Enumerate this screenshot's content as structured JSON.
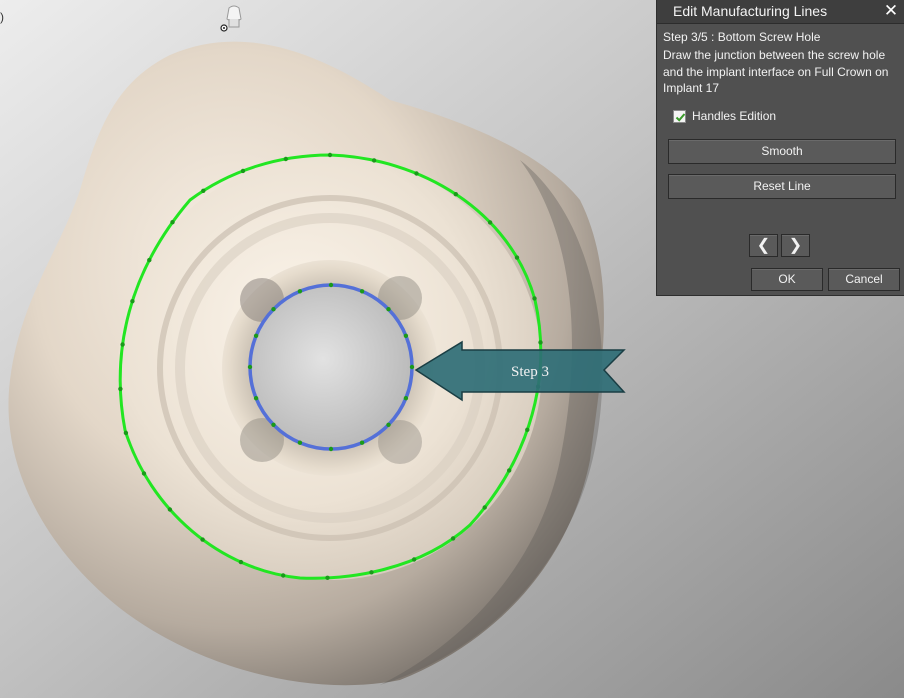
{
  "panel": {
    "title": "Edit Manufacturing Lines",
    "step": "Step 3/5 : Bottom Screw Hole",
    "description": "Draw the junction between the screw hole and the implant interface on Full Crown on Implant 17",
    "handles_label": "Handles Edition",
    "handles_checked": true,
    "smooth_label": "Smooth",
    "reset_label": "Reset Line",
    "prev_symbol": "❮",
    "next_symbol": "❯",
    "ok_label": "OK",
    "cancel_label": "Cancel",
    "close_symbol": "✕"
  },
  "viewport": {
    "arrow_label": "Step 3",
    "edge_mark": ")",
    "colors": {
      "margin_line": "#22e622",
      "screw_line": "#5470d8",
      "handle": "#1a9a1a",
      "arrow_fill": "#2f6e76",
      "crown": "#ece0d0"
    }
  }
}
